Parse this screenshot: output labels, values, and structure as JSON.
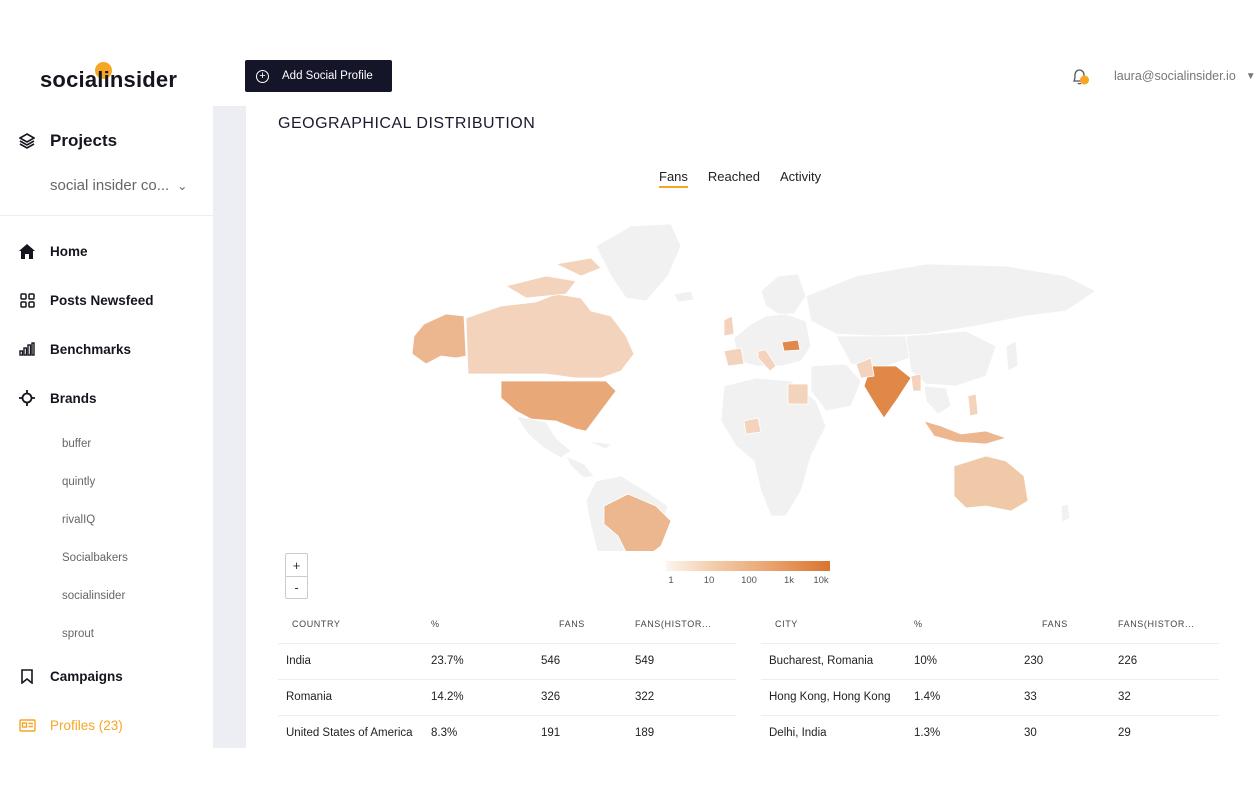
{
  "brand": {
    "logo_text": "socialinsider",
    "accent": "#f6a623"
  },
  "sidebar": {
    "projects_label": "Projects",
    "project_select": "social insider co...",
    "nav": [
      {
        "label": "Home",
        "icon": "home-icon"
      },
      {
        "label": "Posts Newsfeed",
        "icon": "grid-icon"
      },
      {
        "label": "Benchmarks",
        "icon": "bar-chart-icon"
      },
      {
        "label": "Brands",
        "icon": "crosshair-icon"
      },
      {
        "label": "Campaigns",
        "icon": "bookmark-icon"
      },
      {
        "label": "Profiles (23)",
        "icon": "profile-card-icon"
      }
    ],
    "brands": [
      "buffer",
      "quintly",
      "rivalIQ",
      "Socialbakers",
      "socialinsider",
      "sprout"
    ]
  },
  "topbar": {
    "add_profile_label": "Add Social Profile",
    "user_email": "laura@socialinsider.io"
  },
  "card": {
    "title": "GEOGRAPHICAL DISTRIBUTION",
    "tabs": [
      "Fans",
      "Reached",
      "Activity"
    ],
    "active_tab": "Fans",
    "zoom_in": "+",
    "zoom_out": "-",
    "legend_ticks": [
      "1",
      "10",
      "100",
      "1k",
      "10k"
    ]
  },
  "country_table": {
    "headers": [
      "COUNTRY",
      "%",
      "FANS",
      "FANS(HISTOR..."
    ],
    "rows": [
      [
        "India",
        "23.7%",
        "546",
        "549"
      ],
      [
        "Romania",
        "14.2%",
        "326",
        "322"
      ],
      [
        "United States of America",
        "8.3%",
        "191",
        "189"
      ]
    ]
  },
  "city_table": {
    "headers": [
      "CITY",
      "%",
      "FANS",
      "FANS(HISTOR..."
    ],
    "rows": [
      [
        "Bucharest, Romania",
        "10%",
        "230",
        "226"
      ],
      [
        "Hong Kong, Hong Kong",
        "1.4%",
        "33",
        "32"
      ],
      [
        "Delhi, India",
        "1.3%",
        "30",
        "29"
      ]
    ]
  }
}
